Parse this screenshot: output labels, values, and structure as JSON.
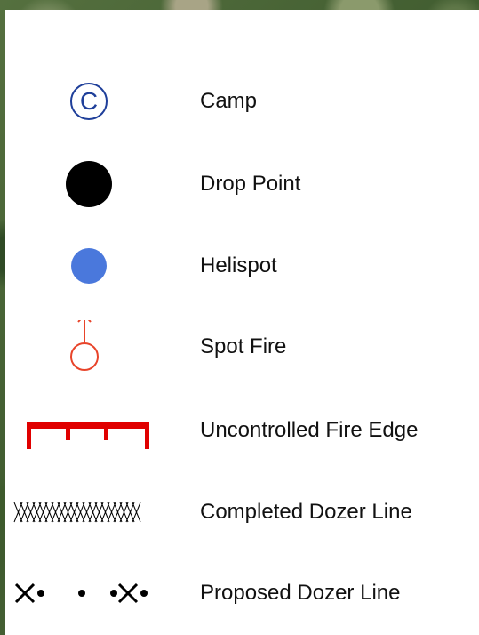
{
  "legend": {
    "items": [
      {
        "key": "camp",
        "label": "Camp",
        "icon": "camp-icon",
        "color": "#1f3f9a"
      },
      {
        "key": "drop_point",
        "label": "Drop Point",
        "icon": "drop-point-icon",
        "color": "#000000"
      },
      {
        "key": "helispot",
        "label": "Helispot",
        "icon": "helispot-icon",
        "color": "#4a78dc"
      },
      {
        "key": "spot_fire",
        "label": "Spot Fire",
        "icon": "spot-fire-icon",
        "color": "#e8442a"
      },
      {
        "key": "uncontrolled_fire_edge",
        "label": "Uncontrolled Fire Edge",
        "icon": "uncontrolled-fire-edge-icon",
        "color": "#e00000"
      },
      {
        "key": "completed_dozer_line",
        "label": "Completed Dozer Line",
        "icon": "completed-dozer-line-icon",
        "color": "#000000"
      },
      {
        "key": "proposed_dozer_line",
        "label": "Proposed Dozer Line",
        "icon": "proposed-dozer-line-icon",
        "color": "#000000"
      }
    ]
  }
}
